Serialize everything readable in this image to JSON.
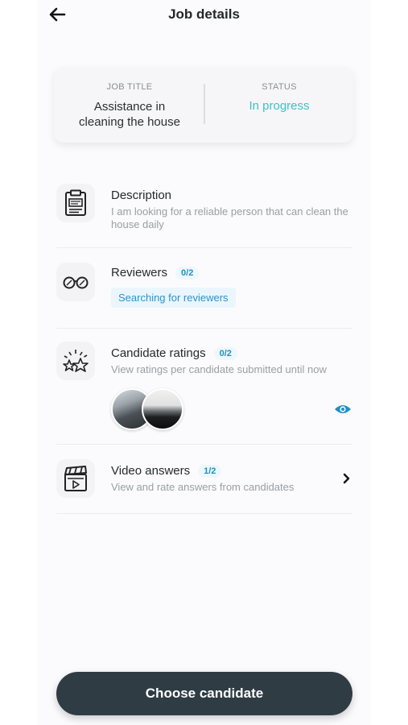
{
  "header": {
    "title": "Job details",
    "back_icon": "arrow-left-icon"
  },
  "summary": {
    "job_title_label": "JOB TITLE",
    "job_title_line1": "Assistance in",
    "job_title_line2": "cleaning the house",
    "status_label": "STATUS",
    "status_value": "In progress",
    "status_color": "#3ac2c9"
  },
  "sections": {
    "description": {
      "icon": "clipboard-icon",
      "title": "Description",
      "text": "I am looking for a reliable person that can clean the house daily"
    },
    "reviewers": {
      "icon": "glasses-icon",
      "title": "Reviewers",
      "count": "0/2",
      "chip": "Searching for reviewers"
    },
    "candidate_ratings": {
      "icon": "star-burst-icon",
      "title": "Candidate ratings",
      "count": "0/2",
      "text": "View ratings per candidate submitted until now",
      "action_icon": "eye-icon"
    },
    "video_answers": {
      "icon": "clapperboard-icon",
      "title": "Video answers",
      "count": "1/2",
      "text": "View and rate answers from candidates",
      "action_icon": "chevron-right-icon"
    }
  },
  "cta": {
    "label": "Choose candidate"
  },
  "colors": {
    "accent": "#1f8fc8",
    "status": "#3ac2c9",
    "cta_bg": "#2f3c44"
  }
}
